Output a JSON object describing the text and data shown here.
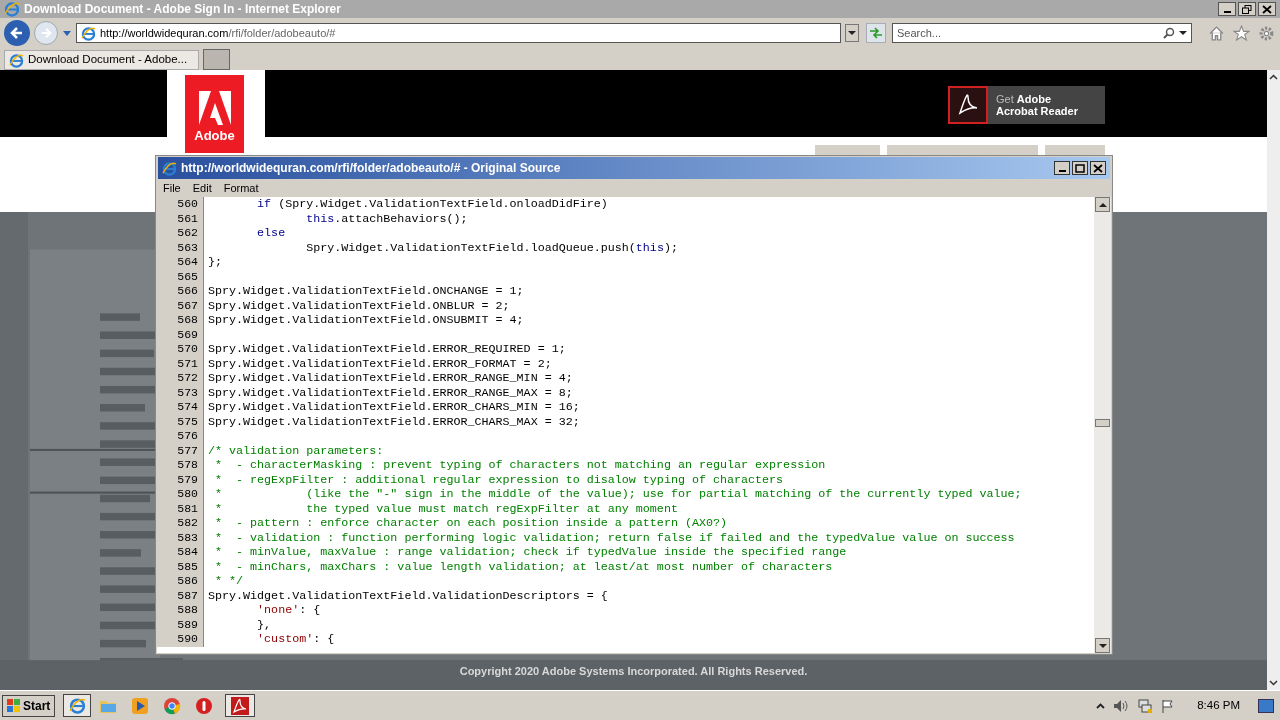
{
  "browser": {
    "title": "Download Document - Adobe Sign In - Internet Explorer",
    "address_host": "http://worldwidequran.com",
    "address_path": "/rfi/folder/adobeauto/#",
    "search_placeholder": "Search...",
    "tab_title": "Download Document - Adobe..."
  },
  "page": {
    "logo_text": "Adobe",
    "acrobat_prefix": "Get",
    "acrobat_bold": "Adobe",
    "acrobat_line2": "Acrobat Reader",
    "copyright": "Copyright 2020 Adobe Systems Incorporated. All Rights Reserved."
  },
  "source_window": {
    "title": "http://worldwidequran.com/rfi/folder/adobeauto/# - Original Source",
    "menu": [
      "File",
      "Edit",
      "Format"
    ],
    "lines": [
      {
        "num": "560",
        "segments": [
          {
            "kind": "keyword",
            "text": "       if"
          },
          {
            "kind": "plain",
            "text": " (Spry.Widget.ValidationTextField.onloadDidFire)"
          }
        ]
      },
      {
        "num": "561",
        "segments": [
          {
            "kind": "keyword",
            "text": "              this"
          },
          {
            "kind": "plain",
            "text": ".attachBehaviors();"
          }
        ]
      },
      {
        "num": "562",
        "segments": [
          {
            "kind": "keyword",
            "text": "       else"
          }
        ]
      },
      {
        "num": "563",
        "segments": [
          {
            "kind": "plain",
            "text": "              Spry.Widget.ValidationTextField.loadQueue.push("
          },
          {
            "kind": "keyword",
            "text": "this"
          },
          {
            "kind": "plain",
            "text": ");"
          }
        ]
      },
      {
        "num": "564",
        "segments": [
          {
            "kind": "plain",
            "text": "};"
          }
        ]
      },
      {
        "num": "565"
      },
      {
        "num": "566",
        "segments": [
          {
            "kind": "plain",
            "text": "Spry.Widget.ValidationTextField.ONCHANGE = 1;"
          }
        ]
      },
      {
        "num": "567",
        "segments": [
          {
            "kind": "plain",
            "text": "Spry.Widget.ValidationTextField.ONBLUR = 2;"
          }
        ]
      },
      {
        "num": "568",
        "segments": [
          {
            "kind": "plain",
            "text": "Spry.Widget.ValidationTextField.ONSUBMIT = 4;"
          }
        ]
      },
      {
        "num": "569"
      },
      {
        "num": "570",
        "segments": [
          {
            "kind": "plain",
            "text": "Spry.Widget.ValidationTextField.ERROR_REQUIRED = 1;"
          }
        ]
      },
      {
        "num": "571",
        "segments": [
          {
            "kind": "plain",
            "text": "Spry.Widget.ValidationTextField.ERROR_FORMAT = 2;"
          }
        ]
      },
      {
        "num": "572",
        "segments": [
          {
            "kind": "plain",
            "text": "Spry.Widget.ValidationTextField.ERROR_RANGE_MIN = 4;"
          }
        ]
      },
      {
        "num": "573",
        "segments": [
          {
            "kind": "plain",
            "text": "Spry.Widget.ValidationTextField.ERROR_RANGE_MAX = 8;"
          }
        ]
      },
      {
        "num": "574",
        "segments": [
          {
            "kind": "plain",
            "text": "Spry.Widget.ValidationTextField.ERROR_CHARS_MIN = 16;"
          }
        ]
      },
      {
        "num": "575",
        "segments": [
          {
            "kind": "plain",
            "text": "Spry.Widget.ValidationTextField.ERROR_CHARS_MAX = 32;"
          }
        ]
      },
      {
        "num": "576"
      },
      {
        "num": "577",
        "segments": [
          {
            "kind": "comment",
            "text": "/* validation parameters:"
          }
        ]
      },
      {
        "num": "578",
        "segments": [
          {
            "kind": "comment",
            "text": " *  - characterMasking : prevent typing of characters not matching an regular expression"
          }
        ]
      },
      {
        "num": "579",
        "segments": [
          {
            "kind": "comment",
            "text": " *  - regExpFilter : additional regular expression to disalow typing of characters"
          }
        ]
      },
      {
        "num": "580",
        "segments": [
          {
            "kind": "comment",
            "text": " *            (like the \"-\" sign in the middle of the value); use for partial matching of the currently typed value;"
          }
        ]
      },
      {
        "num": "581",
        "segments": [
          {
            "kind": "comment",
            "text": " *            the typed value must match regExpFilter at any moment"
          }
        ]
      },
      {
        "num": "582",
        "segments": [
          {
            "kind": "comment",
            "text": " *  - pattern : enforce character on each position inside a pattern (AX0?)"
          }
        ]
      },
      {
        "num": "583",
        "segments": [
          {
            "kind": "comment",
            "text": " *  - validation : function performing logic validation; return false if failed and the typedValue value on success"
          }
        ]
      },
      {
        "num": "584",
        "segments": [
          {
            "kind": "comment",
            "text": " *  - minValue, maxValue : range validation; check if typedValue inside the specified range"
          }
        ]
      },
      {
        "num": "585",
        "segments": [
          {
            "kind": "comment",
            "text": " *  - minChars, maxChars : value length validation; at least/at most number of characters"
          }
        ]
      },
      {
        "num": "586",
        "segments": [
          {
            "kind": "comment",
            "text": " * */"
          }
        ]
      },
      {
        "num": "587",
        "segments": [
          {
            "kind": "plain",
            "text": "Spry.Widget.ValidationTextField.ValidationDescriptors = {"
          }
        ]
      },
      {
        "num": "588",
        "segments": [
          {
            "kind": "string",
            "text": "       'none'"
          },
          {
            "kind": "plain",
            "text": ": {"
          }
        ]
      },
      {
        "num": "589",
        "segments": [
          {
            "kind": "plain",
            "text": "       },"
          }
        ]
      },
      {
        "num": "590",
        "segments": [
          {
            "kind": "string",
            "text": "       'custom'"
          },
          {
            "kind": "plain",
            "text": ": {"
          }
        ]
      }
    ]
  },
  "taskbar": {
    "start": "Start",
    "time": "8:46 PM"
  }
}
